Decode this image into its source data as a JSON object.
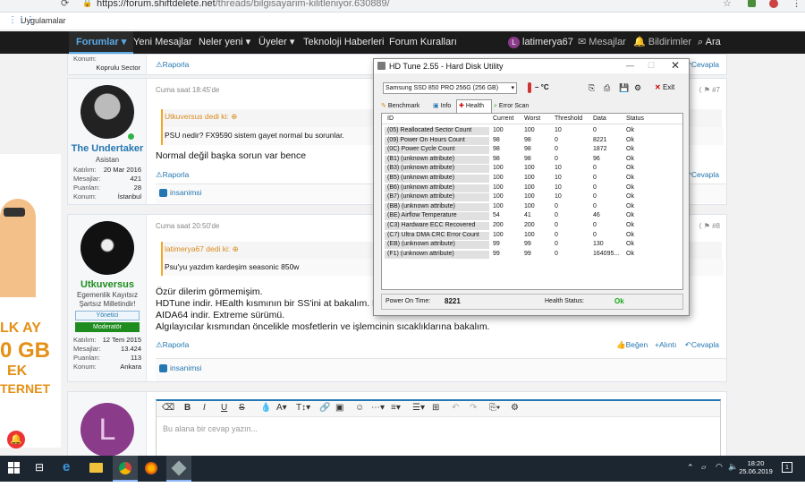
{
  "browser": {
    "url_host": "https://forum.shiftdelete.net",
    "url_path": "/threads/bilgisayarim-kilitleniyor.630889/",
    "bookmark_apps": "Uygulamalar"
  },
  "nav": {
    "items": [
      "Forumlar",
      "Yeni Mesajlar",
      "Neler yeni",
      "Üyeler",
      "Teknoloji Haberleri",
      "Forum Kuralları"
    ],
    "user": "latimerya67",
    "messages": "Mesajlar",
    "alerts": "Bildirimler",
    "search": "Ara",
    "user_initial": "L"
  },
  "prev_post": {
    "loc_label": "Konum:",
    "loc_value": "Koprulu Sector",
    "report": "Raporla",
    "reply": "Cevapla"
  },
  "post7": {
    "time": "Cuma saat 18:45'de",
    "number": "#7",
    "username": "The Undertaker",
    "user_title": "Asistan",
    "stats": [
      {
        "label": "Katılım:",
        "value": "20 Mar 2016"
      },
      {
        "label": "Mesajlar:",
        "value": "421"
      },
      {
        "label": "Puanları:",
        "value": "28"
      },
      {
        "label": "Konum:",
        "value": "İstanbul"
      }
    ],
    "quote_head": "Utkuversus dedi ki:",
    "quote_text": "PSU nedir? FX9590 sistem gayet normal bu sorunlar.",
    "body": "Normal değil başka sorun var bence",
    "report": "Raporla",
    "reply": "Cevapla",
    "like_user": "insanimsi"
  },
  "post8": {
    "time": "Cuma saat 20:50'de",
    "number": "#8",
    "username": "Utkuversus",
    "user_title_1": "Egemenlik Kayıtsız",
    "user_title_2": "Şartsız Milletindir!",
    "badge_1": "Yönetici",
    "badge_2": "Moderatör",
    "stats": [
      {
        "label": "Katılım:",
        "value": "12 Tem 2015"
      },
      {
        "label": "Mesajlar:",
        "value": "13.424"
      },
      {
        "label": "Puanları:",
        "value": "113"
      },
      {
        "label": "Konum:",
        "value": "Ankara"
      }
    ],
    "quote_head": "latimerya67 dedi ki:",
    "quote_text": "Psu'yu yazdım kardeşim seasonic 850w",
    "body_lines": [
      "Özür dilerim görmemişim.",
      "HDTune indir. HEalth kısmının bir SS'ini at bakalım. Birde;",
      "AIDA64 indir. Extreme sürümü.",
      "Algılayıcılar kısmından öncelikle mosfetlerin ve işlemcinin sıcaklıklarına bakalım."
    ],
    "report": "Raporla",
    "like": "Beğen",
    "quote": "Alıntı",
    "reply": "Cevapla",
    "like_user": "insanimsi"
  },
  "editor": {
    "placeholder": "Bu alana bir cevap yazın..."
  },
  "ad": {
    "line1": "LK AY",
    "line2": "0 GB",
    "line3": "EK",
    "line4": "TERNET"
  },
  "hdtune": {
    "title": "HD Tune 2.55 - Hard Disk Utility",
    "drive": "Samsung SSD 850 PRO 256G (256 GB)",
    "temp": "– °C",
    "exit": "Exit",
    "tabs": [
      "Benchmark",
      "Info",
      "Health",
      "Error Scan"
    ],
    "columns": [
      "ID",
      "Current",
      "Worst",
      "Threshold",
      "Data",
      "Status"
    ],
    "rows": [
      [
        "(05) Reallocated Sector Count",
        "100",
        "100",
        "10",
        "0",
        "Ok"
      ],
      [
        "(09) Power On Hours Count",
        "98",
        "98",
        "0",
        "8221",
        "Ok"
      ],
      [
        "(0C) Power Cycle Count",
        "98",
        "98",
        "0",
        "1872",
        "Ok"
      ],
      [
        "(B1) (unknown attribute)",
        "98",
        "98",
        "0",
        "96",
        "Ok"
      ],
      [
        "(B3) (unknown attribute)",
        "100",
        "100",
        "10",
        "0",
        "Ok"
      ],
      [
        "(B5) (unknown attribute)",
        "100",
        "100",
        "10",
        "0",
        "Ok"
      ],
      [
        "(B6) (unknown attribute)",
        "100",
        "100",
        "10",
        "0",
        "Ok"
      ],
      [
        "(B7) (unknown attribute)",
        "100",
        "100",
        "10",
        "0",
        "Ok"
      ],
      [
        "(BB) (unknown attribute)",
        "100",
        "100",
        "0",
        "0",
        "Ok"
      ],
      [
        "(BE) Airflow Temperature",
        "54",
        "41",
        "0",
        "46",
        "Ok"
      ],
      [
        "(C3) Hardware ECC Recovered",
        "200",
        "200",
        "0",
        "0",
        "Ok"
      ],
      [
        "(C7) Ultra DMA CRC Error Count",
        "100",
        "100",
        "0",
        "0",
        "Ok"
      ],
      [
        "(EB) (unknown attribute)",
        "99",
        "99",
        "0",
        "130",
        "Ok"
      ],
      [
        "(F1) (unknown attribute)",
        "99",
        "99",
        "0",
        "164095...",
        "Ok"
      ]
    ],
    "power_on_label": "Power On Time:",
    "power_on_value": "8221",
    "health_label": "Health Status:",
    "health_value": "Ok"
  },
  "taskbar": {
    "time": "18:20",
    "date": "25.06.2019",
    "notif_count": "1"
  },
  "colors": {
    "nav_bg": "#1b1b1b",
    "link": "#2577b1",
    "quote_accent": "#f5a623",
    "moderator_badge": "#1e8c1e",
    "taskbar": "#1c2631",
    "health_ok": "#11aa11"
  }
}
